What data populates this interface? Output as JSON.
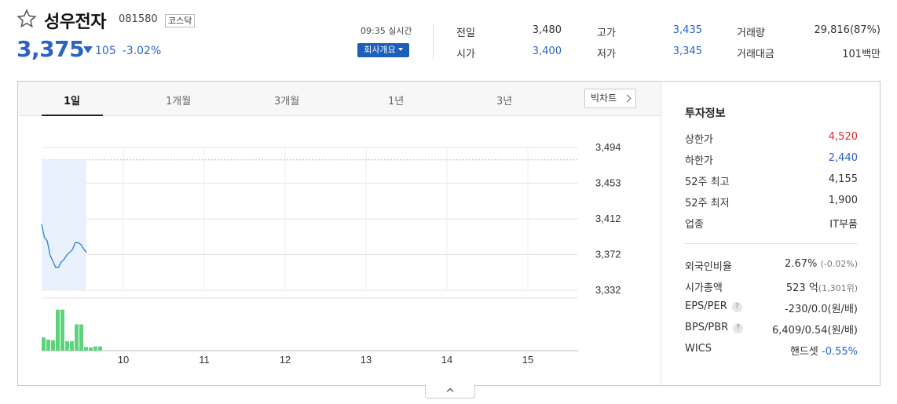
{
  "stock": {
    "name": "성우전자",
    "code": "081580",
    "market": "코스닥",
    "price": "3,375",
    "change": "105",
    "change_rate": "-3.02%",
    "realtime": "09:35 실시간",
    "company_button": "회사개요",
    "accent_color": "#2b63c6"
  },
  "quote": {
    "prev_label": "전일",
    "prev": "3,480",
    "open_label": "시가",
    "open": "3,400",
    "high_label": "고가",
    "high": "3,435",
    "low_label": "저가",
    "low": "3,345",
    "volume_label": "거래량",
    "volume": "29,816(87%)",
    "amount_label": "거래대금",
    "amount": "101백만"
  },
  "tabs": [
    "1일",
    "1개월",
    "3개월",
    "1년",
    "3년"
  ],
  "big_chart_label": "빅차트",
  "chart_data": {
    "type": "line",
    "x_ticks": [
      "10",
      "11",
      "12",
      "13",
      "14",
      "15"
    ],
    "y_ticks": [
      "3,494",
      "3,453",
      "3,412",
      "3,372",
      "3,332"
    ],
    "ylim": [
      3332,
      3494
    ],
    "reference_value": 3480,
    "price_series": [
      3407,
      3392,
      3388,
      3372,
      3365,
      3358,
      3358,
      3364,
      3367,
      3372,
      3375,
      3378,
      3386,
      3386,
      3384,
      3379,
      3375
    ],
    "volume_series": [
      0.25,
      0.21,
      0.2,
      0.78,
      0.78,
      0.18,
      0.18,
      0.5,
      0.5,
      0.07,
      0.06,
      0.08,
      0.08
    ],
    "line_color": "#2f7fd8",
    "volume_color": "#5dd47c"
  },
  "info": {
    "title": "투자정보",
    "rows1": [
      {
        "k": "상한가",
        "v": "4,520",
        "color": "red"
      },
      {
        "k": "하한가",
        "v": "2,440",
        "color": "blue"
      },
      {
        "k": "52주 최고",
        "v": "4,155",
        "color": ""
      },
      {
        "k": "52주 최저",
        "v": "1,900",
        "color": ""
      },
      {
        "k": "업종",
        "v": "IT부품",
        "color": ""
      }
    ],
    "foreign_label": "외국인비율",
    "foreign": "2.67%",
    "foreign_sub": "(-0.02%)",
    "mcap_label": "시가총액",
    "mcap": "523 억",
    "mcap_sub": "(1,301위)",
    "eps_label": "EPS/PER",
    "eps": "-230/0.0",
    "eps_sub": "(원/배)",
    "bps_label": "BPS/PBR",
    "bps": "6,409/0.54",
    "bps_sub": "(원/배)",
    "wics_label": "WICS",
    "wics": "핸드셋",
    "wics_rate": "-0.55%",
    "help_glyph": "?"
  }
}
